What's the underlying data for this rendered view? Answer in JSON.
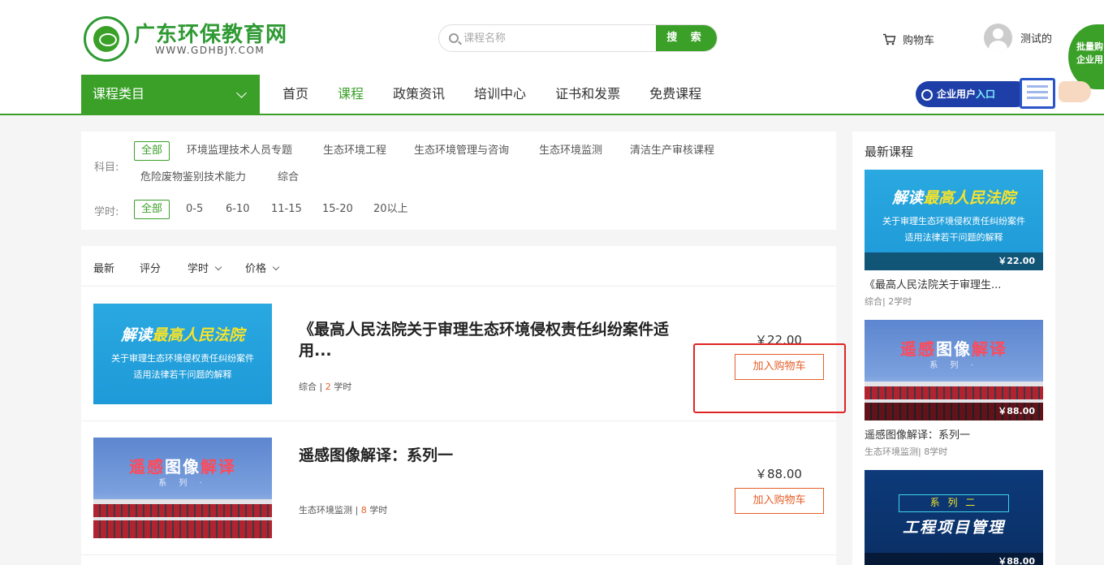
{
  "brand": {
    "name": "广东环保教育网",
    "domain": "WWW.GDHBJY.COM"
  },
  "search": {
    "placeholder": "课程名称",
    "button": "搜 索"
  },
  "header": {
    "cart": "购物车",
    "user": "测试的",
    "bulk_line1": "批量购",
    "bulk_line2": "企业用"
  },
  "nav": {
    "category": "课程类目",
    "items": [
      "首页",
      "课程",
      "政策资讯",
      "培训中心",
      "证书和发票",
      "免费课程"
    ],
    "active": "课程"
  },
  "enterprise": {
    "label_a": "企业用户",
    "label_b": "入口"
  },
  "filters": {
    "subject_label": "科目:",
    "subjects": [
      "全部",
      "环境监理技术人员专题",
      "生态环境工程",
      "生态环境管理与咨询",
      "生态环境监测",
      "清洁生产审核课程",
      "危险废物鉴别技术能力",
      "综合"
    ],
    "hours_label": "学时:",
    "hours": [
      "全部",
      "0-5",
      "6-10",
      "11-15",
      "15-20",
      "20以上"
    ]
  },
  "sort": {
    "latest": "最新",
    "rating": "评分",
    "hours": "学时",
    "price": "价格"
  },
  "courses": [
    {
      "title": "《最高人民法院关于审理生态环境侵权责任纠纷案件适用...",
      "category": "综合",
      "hours_num": "2",
      "hours_unit": "学时",
      "price": "￥22.00",
      "cart": "加入购物车",
      "thumb_a": "解读",
      "thumb_b": "最高人民法院",
      "thumb_line1": "关于审理生态环境侵权责任纠纷案件",
      "thumb_line2": "适用法律若干问题的解释"
    },
    {
      "title": "遥感图像解译：系列一",
      "category": "生态环境监测",
      "hours_num": "8",
      "hours_unit": "学时",
      "price": "￥88.00",
      "cart": "加入购物车",
      "thumb_a": "遥感",
      "thumb_b": "图像",
      "thumb_c": "解译",
      "thumb_series": "系 列 ·"
    }
  ],
  "sidebar": {
    "title": "最新课程",
    "items": [
      {
        "name": "《最高人民法院关于审理生...",
        "meta": "综合| 2学时",
        "price": "￥22.00"
      },
      {
        "name": "遥感图像解译：系列一",
        "meta": "生态环境监测| 8学时",
        "price": "￥88.00"
      },
      {
        "name": "",
        "meta": "",
        "price": "￥88.00",
        "thumb_tag": "系 列 二",
        "thumb_title": "工程项目管理"
      }
    ]
  },
  "colors": {
    "brand_green": "#3aa028",
    "accent_orange": "#e5602a",
    "highlight_red": "#e02424"
  }
}
